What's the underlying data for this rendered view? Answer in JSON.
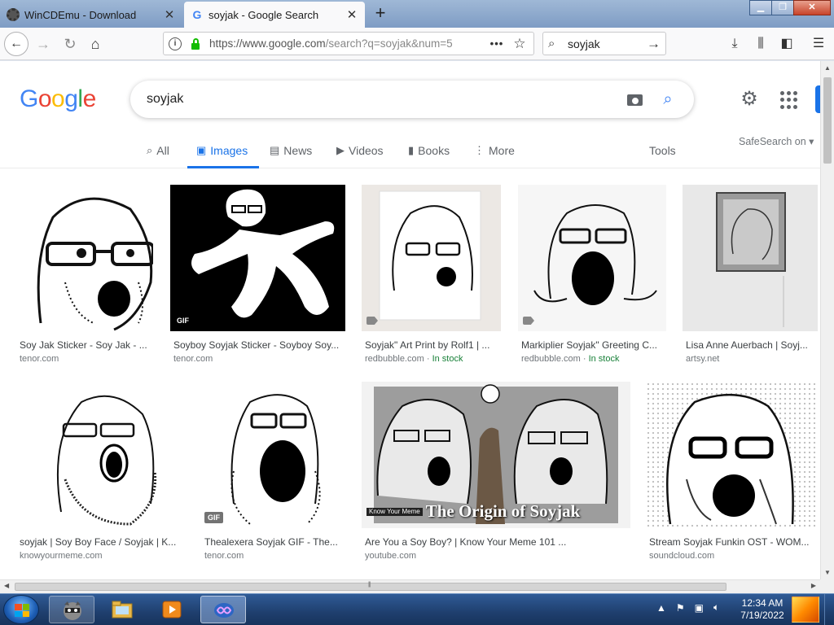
{
  "browser": {
    "tabs": [
      {
        "title": "WinCDEmu - Download",
        "active": false
      },
      {
        "title": "soyjak - Google Search",
        "active": true
      }
    ],
    "url": {
      "main": "https://www.google.com",
      "rest": "/search?q=soyjak&num=5"
    },
    "search_box": "soyjak"
  },
  "google": {
    "logo_letters": [
      {
        "ch": "G",
        "color": "#4285f4"
      },
      {
        "ch": "o",
        "color": "#ea4335"
      },
      {
        "ch": "o",
        "color": "#fbbc05"
      },
      {
        "ch": "g",
        "color": "#4285f4"
      },
      {
        "ch": "l",
        "color": "#34a853"
      },
      {
        "ch": "e",
        "color": "#ea4335"
      }
    ],
    "query": "soyjak",
    "tabs": [
      {
        "label": "All",
        "icon": "search-icon"
      },
      {
        "label": "Images",
        "icon": "image-icon",
        "active": true
      },
      {
        "label": "News",
        "icon": "news-icon"
      },
      {
        "label": "Videos",
        "icon": "video-icon"
      },
      {
        "label": "Books",
        "icon": "book-icon"
      },
      {
        "label": "More",
        "icon": "more-icon"
      }
    ],
    "tools_label": "Tools",
    "safesearch_label": "SafeSearch on"
  },
  "results": [
    {
      "title": "Soy Jak Sticker - Soy Jak - ...",
      "source": "tenor.com",
      "stock": "",
      "badge": ""
    },
    {
      "title": "Soyboy Soyjak Sticker - Soyboy Soy...",
      "source": "tenor.com",
      "stock": "",
      "badge": "GIF"
    },
    {
      "title": "Soyjak\" Art Print by Rolf1 | ...",
      "source": "redbubble.com",
      "stock": "In stock",
      "badge": "tag"
    },
    {
      "title": "Markiplier Soyjak\" Greeting C...",
      "source": "redbubble.com",
      "stock": "In stock",
      "badge": "tag"
    },
    {
      "title": "Lisa Anne Auerbach | Soyj...",
      "source": "artsy.net",
      "stock": "",
      "badge": ""
    },
    {
      "title": "soyjak | Soy Boy Face / Soyjak | K...",
      "source": "knowyourmeme.com",
      "stock": "",
      "badge": ""
    },
    {
      "title": "Thealexera Soyjak GIF - The...",
      "source": "tenor.com",
      "stock": "",
      "badge": "GIF"
    },
    {
      "title": "Are You a Soy Boy? | Know Your Meme 101 ...",
      "source": "youtube.com",
      "stock": "",
      "badge": "",
      "caption_small": "Know Your Meme",
      "caption_big": "The Origin of Soyjak"
    },
    {
      "title": "Stream Soyjak Funkin OST - WOM...",
      "source": "soundcloud.com",
      "stock": "",
      "badge": ""
    }
  ],
  "taskbar": {
    "time": "12:34 AM",
    "date": "7/19/2022"
  }
}
